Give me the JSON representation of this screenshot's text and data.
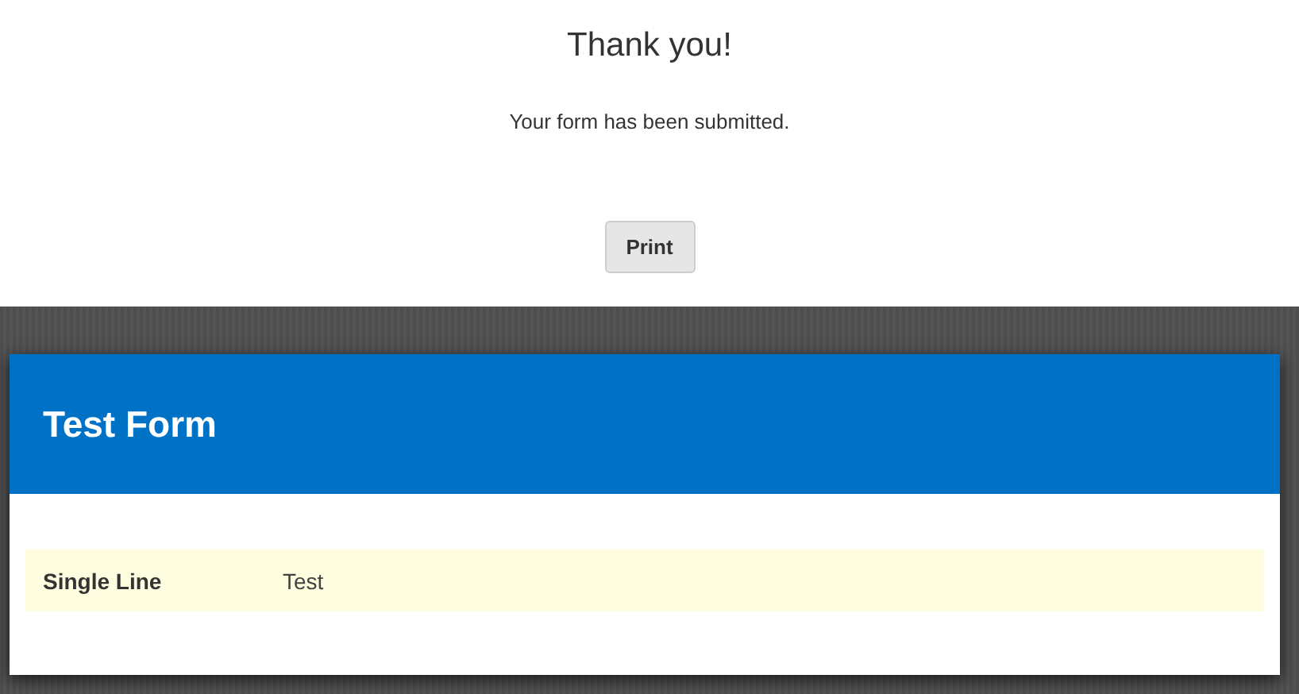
{
  "confirmation": {
    "title": "Thank you!",
    "message": "Your form has been submitted.",
    "button": "Print"
  },
  "form": {
    "title": "Test Form",
    "fields": [
      {
        "label": "Single Line",
        "value": "Test"
      }
    ]
  }
}
